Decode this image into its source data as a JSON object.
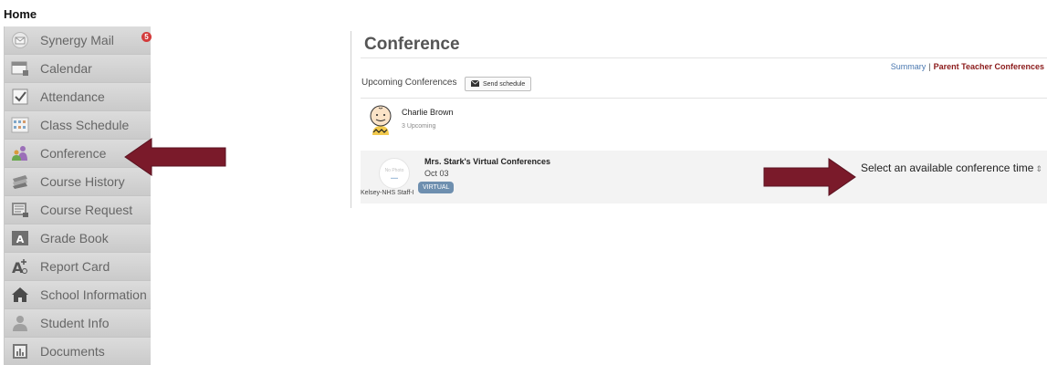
{
  "header": {
    "title": "Home"
  },
  "sidebar": {
    "items": [
      {
        "label": "Synergy Mail",
        "icon": "mail-icon",
        "badge": "5"
      },
      {
        "label": "Calendar",
        "icon": "calendar-icon"
      },
      {
        "label": "Attendance",
        "icon": "attendance-check-icon"
      },
      {
        "label": "Class Schedule",
        "icon": "class-schedule-icon"
      },
      {
        "label": "Conference",
        "icon": "conference-people-icon"
      },
      {
        "label": "Course History",
        "icon": "course-history-icon"
      },
      {
        "label": "Course Request",
        "icon": "course-request-icon"
      },
      {
        "label": "Grade Book",
        "icon": "grade-book-icon"
      },
      {
        "label": "Report Card",
        "icon": "report-card-icon"
      },
      {
        "label": "School Information",
        "icon": "school-house-icon"
      },
      {
        "label": "Student Info",
        "icon": "student-person-icon"
      },
      {
        "label": "Documents",
        "icon": "documents-icon"
      }
    ]
  },
  "main": {
    "title": "Conference",
    "links": {
      "summary": "Summary",
      "separator": "|",
      "ptc": "Parent Teacher Conferences"
    },
    "upcoming_label": "Upcoming Conferences",
    "send_schedule_label": "Send schedule",
    "student": {
      "name": "Charlie Brown",
      "upcoming": "3 Upcoming"
    },
    "conference": {
      "title": "Mrs. Stark's Virtual Conferences",
      "date": "Oct 03",
      "badge": "VIRTUAL",
      "photo_text": "No Photo",
      "staff": "Kelsey-NHS Staff-I",
      "action": "Select an available conference time"
    }
  },
  "colors": {
    "accent_red": "#8b1a1a",
    "link_blue": "#4a78b0",
    "arrow": "#7a1a2a"
  }
}
